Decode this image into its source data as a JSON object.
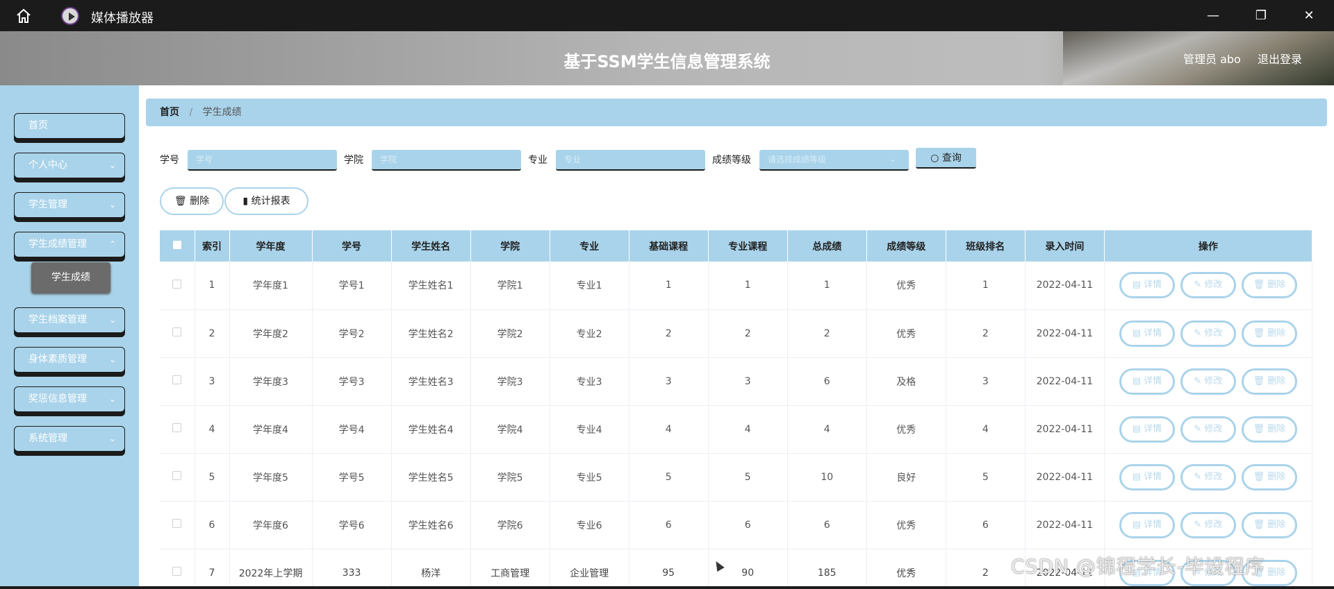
{
  "window": {
    "title": "媒体播放器",
    "controls": {
      "minimize": "—",
      "maximize": "❐",
      "close": "✕"
    }
  },
  "header": {
    "title": "基于SSM学生信息管理系统",
    "user": "管理员 abo",
    "logout": "退出登录"
  },
  "sidebar": {
    "items": [
      {
        "label": "首页",
        "has_arrow": false
      },
      {
        "label": "个人中心",
        "has_arrow": true
      },
      {
        "label": "学生管理",
        "has_arrow": true
      },
      {
        "label": "学生成绩管理",
        "has_arrow": true
      },
      {
        "label": "学生档案管理",
        "has_arrow": true
      },
      {
        "label": "身体素质管理",
        "has_arrow": true
      },
      {
        "label": "奖惩信息管理",
        "has_arrow": true
      },
      {
        "label": "系统管理",
        "has_arrow": true
      }
    ],
    "active_sub_item": "学生成绩"
  },
  "breadcrumb": {
    "home": "首页",
    "separator": "/",
    "current": "学生成绩"
  },
  "search": {
    "student_id_label": "学号",
    "student_id_placeholder": "学号",
    "college_label": "学院",
    "college_placeholder": "学院",
    "major_label": "专业",
    "major_placeholder": "专业",
    "grade_label": "成绩等级",
    "grade_placeholder": "请选择成绩等级",
    "query_button": "查询"
  },
  "actions": {
    "delete": "删除",
    "report": "统计报表"
  },
  "table": {
    "columns": [
      "索引",
      "学年度",
      "学号",
      "学生姓名",
      "学院",
      "专业",
      "基础课程",
      "专业课程",
      "总成绩",
      "成绩等级",
      "班级排名",
      "录入时间",
      "操作"
    ],
    "row_actions": {
      "detail": "详情",
      "edit": "修改",
      "delete": "删除"
    },
    "rows": [
      [
        "1",
        "学年度1",
        "学号1",
        "学生姓名1",
        "学院1",
        "专业1",
        "1",
        "1",
        "1",
        "优秀",
        "1",
        "2022-04-11"
      ],
      [
        "2",
        "学年度2",
        "学号2",
        "学生姓名2",
        "学院2",
        "专业2",
        "2",
        "2",
        "2",
        "优秀",
        "2",
        "2022-04-11"
      ],
      [
        "3",
        "学年度3",
        "学号3",
        "学生姓名3",
        "学院3",
        "专业3",
        "3",
        "3",
        "6",
        "及格",
        "3",
        "2022-04-11"
      ],
      [
        "4",
        "学年度4",
        "学号4",
        "学生姓名4",
        "学院4",
        "专业4",
        "4",
        "4",
        "4",
        "优秀",
        "4",
        "2022-04-11"
      ],
      [
        "5",
        "学年度5",
        "学号5",
        "学生姓名5",
        "学院5",
        "专业5",
        "5",
        "5",
        "10",
        "良好",
        "5",
        "2022-04-11"
      ],
      [
        "6",
        "学年度6",
        "学号6",
        "学生姓名6",
        "学院6",
        "专业6",
        "6",
        "6",
        "6",
        "优秀",
        "6",
        "2022-04-11"
      ],
      [
        "7",
        "2022年上学期",
        "333",
        "杨洋",
        "工商管理",
        "企业管理",
        "95",
        "90",
        "185",
        "优秀",
        "2",
        "2022-04-11"
      ]
    ]
  },
  "watermark": "CSDN @锦程学长-毕设程序",
  "colors": {
    "accent": "#a9d3ea",
    "dark": "#1b1b1b",
    "submenu_active": "#6b6b6b"
  }
}
